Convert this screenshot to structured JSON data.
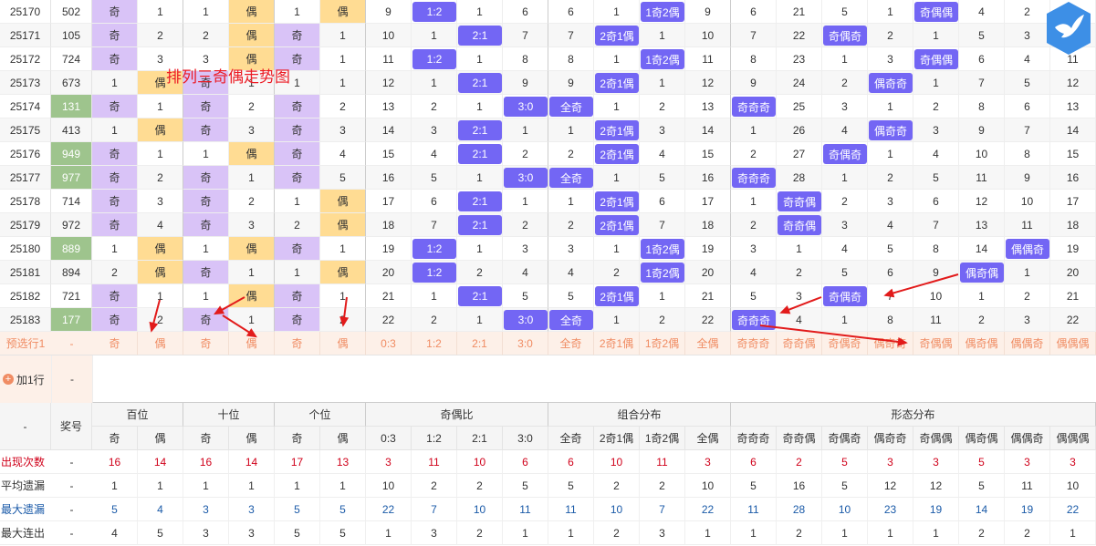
{
  "overlay_title": "排列三奇偶走势图",
  "colors": {
    "purple_cell": "#d9c3f7",
    "yellow_cell": "#ffdc93",
    "green_cell": "#9ec48d",
    "blue_block": "#7366f4",
    "predict_text": "#f08c63",
    "row_alt": "#f7f7f7"
  },
  "group_headers": {
    "award": "奖号",
    "hundreds": "百位",
    "tens": "十位",
    "units": "个位",
    "ratio": "奇偶比",
    "combo": "组合分布",
    "form": "形态分布",
    "dash": "-"
  },
  "sub_headers": [
    "奇",
    "偶",
    "奇",
    "偶",
    "奇",
    "偶",
    "0:3",
    "1:2",
    "2:1",
    "3:0",
    "全奇",
    "2奇1偶",
    "1奇2偶",
    "全偶",
    "奇奇奇",
    "奇奇偶",
    "奇偶奇",
    "偶奇奇",
    "奇偶偶",
    "偶奇偶",
    "偶偶奇",
    "偶偶偶"
  ],
  "rows": [
    {
      "issue": "25170",
      "num": "502",
      "cells": [
        "奇",
        "1",
        "1",
        "偶",
        "1",
        "偶",
        "9",
        "1:2",
        "1",
        "6",
        "6",
        "1",
        "1奇2偶",
        "9",
        "6",
        "21",
        "5",
        "1",
        "奇偶偶",
        "4",
        "2",
        ""
      ]
    },
    {
      "issue": "25171",
      "num": "105",
      "cells": [
        "奇",
        "2",
        "2",
        "偶",
        "奇",
        "1",
        "10",
        "1",
        "2:1",
        "7",
        "7",
        "2奇1偶",
        "1",
        "10",
        "7",
        "22",
        "奇偶奇",
        "2",
        "1",
        "5",
        "3",
        ""
      ]
    },
    {
      "issue": "25172",
      "num": "724",
      "cells": [
        "奇",
        "3",
        "3",
        "偶",
        "奇",
        "1",
        "11",
        "1:2",
        "1",
        "8",
        "8",
        "1",
        "1奇2偶",
        "11",
        "8",
        "23",
        "1",
        "3",
        "奇偶偶",
        "6",
        "4",
        "11"
      ]
    },
    {
      "issue": "25173",
      "num": "673",
      "cells": [
        "1",
        "偶",
        "奇",
        "1",
        "1",
        "1",
        "12",
        "1",
        "2:1",
        "9",
        "9",
        "2奇1偶",
        "1",
        "12",
        "9",
        "24",
        "2",
        "偶奇奇",
        "1",
        "7",
        "5",
        "12"
      ]
    },
    {
      "issue": "25174",
      "num": "131",
      "cells": [
        "奇",
        "1",
        "奇",
        "2",
        "奇",
        "2",
        "13",
        "2",
        "1",
        "3:0",
        "全奇",
        "1",
        "2",
        "13",
        "奇奇奇",
        "25",
        "3",
        "1",
        "2",
        "8",
        "6",
        "13"
      ]
    },
    {
      "issue": "25175",
      "num": "413",
      "cells": [
        "1",
        "偶",
        "奇",
        "3",
        "奇",
        "3",
        "14",
        "3",
        "2:1",
        "1",
        "1",
        "2奇1偶",
        "3",
        "14",
        "1",
        "26",
        "4",
        "偶奇奇",
        "3",
        "9",
        "7",
        "14"
      ]
    },
    {
      "issue": "25176",
      "num": "949",
      "cells": [
        "奇",
        "1",
        "1",
        "偶",
        "奇",
        "4",
        "15",
        "4",
        "2:1",
        "2",
        "2",
        "2奇1偶",
        "4",
        "15",
        "2",
        "27",
        "奇偶奇",
        "1",
        "4",
        "10",
        "8",
        "15"
      ]
    },
    {
      "issue": "25177",
      "num": "977",
      "cells": [
        "奇",
        "2",
        "奇",
        "1",
        "奇",
        "5",
        "16",
        "5",
        "1",
        "3:0",
        "全奇",
        "1",
        "5",
        "16",
        "奇奇奇",
        "28",
        "1",
        "2",
        "5",
        "11",
        "9",
        "16"
      ]
    },
    {
      "issue": "25178",
      "num": "714",
      "cells": [
        "奇",
        "3",
        "奇",
        "2",
        "1",
        "偶",
        "17",
        "6",
        "2:1",
        "1",
        "1",
        "2奇1偶",
        "6",
        "17",
        "1",
        "奇奇偶",
        "2",
        "3",
        "6",
        "12",
        "10",
        "17"
      ]
    },
    {
      "issue": "25179",
      "num": "972",
      "cells": [
        "奇",
        "4",
        "奇",
        "3",
        "2",
        "偶",
        "18",
        "7",
        "2:1",
        "2",
        "2",
        "2奇1偶",
        "7",
        "18",
        "2",
        "奇奇偶",
        "3",
        "4",
        "7",
        "13",
        "11",
        "18"
      ]
    },
    {
      "issue": "25180",
      "num": "889",
      "cells": [
        "1",
        "偶",
        "1",
        "偶",
        "奇",
        "1",
        "19",
        "1:2",
        "1",
        "3",
        "3",
        "1",
        "1奇2偶",
        "19",
        "3",
        "1",
        "4",
        "5",
        "8",
        "14",
        "偶偶奇",
        "19"
      ]
    },
    {
      "issue": "25181",
      "num": "894",
      "cells": [
        "2",
        "偶",
        "奇",
        "1",
        "1",
        "偶",
        "20",
        "1:2",
        "2",
        "4",
        "4",
        "2",
        "1奇2偶",
        "20",
        "4",
        "2",
        "5",
        "6",
        "9",
        "偶奇偶",
        "1",
        "20"
      ]
    },
    {
      "issue": "25182",
      "num": "721",
      "cells": [
        "奇",
        "1",
        "1",
        "偶",
        "奇",
        "1",
        "21",
        "1",
        "2:1",
        "5",
        "5",
        "2奇1偶",
        "1",
        "21",
        "5",
        "3",
        "奇偶奇",
        "7",
        "10",
        "1",
        "2",
        "21"
      ]
    },
    {
      "issue": "25183",
      "num": "177",
      "cells": [
        "奇",
        "2",
        "奇",
        "1",
        "奇",
        "2",
        "22",
        "2",
        "1",
        "3:0",
        "全奇",
        "1",
        "2",
        "22",
        "奇奇奇",
        "4",
        "1",
        "8",
        "11",
        "2",
        "3",
        "22"
      ]
    }
  ],
  "predict": {
    "label": "预选行1",
    "dash": "-",
    "cells": [
      "奇",
      "偶",
      "奇",
      "偶",
      "奇",
      "偶",
      "0:3",
      "1:2",
      "2:1",
      "3:0",
      "全奇",
      "2奇1偶",
      "1奇2偶",
      "全偶",
      "奇奇奇",
      "奇奇偶",
      "奇偶奇",
      "偶奇奇",
      "奇偶偶",
      "偶奇偶",
      "偶偶奇",
      "偶偶偶"
    ]
  },
  "add_row": {
    "label": "加1行",
    "dash": "-"
  },
  "stats": [
    {
      "label": "出现次数",
      "dash": "-",
      "values": [
        "16",
        "14",
        "16",
        "14",
        "17",
        "13",
        "3",
        "11",
        "10",
        "6",
        "6",
        "10",
        "11",
        "3",
        "6",
        "2",
        "5",
        "3",
        "3",
        "5",
        "3",
        "3"
      ]
    },
    {
      "label": "平均遗漏",
      "dash": "-",
      "values": [
        "1",
        "1",
        "1",
        "1",
        "1",
        "1",
        "10",
        "2",
        "2",
        "5",
        "5",
        "2",
        "2",
        "10",
        "5",
        "16",
        "5",
        "12",
        "12",
        "5",
        "11",
        "10"
      ]
    },
    {
      "label": "最大遗漏",
      "dash": "-",
      "values": [
        "5",
        "4",
        "3",
        "3",
        "5",
        "5",
        "22",
        "7",
        "10",
        "11",
        "11",
        "10",
        "7",
        "22",
        "11",
        "28",
        "10",
        "23",
        "19",
        "14",
        "19",
        "22"
      ]
    },
    {
      "label": "最大连出",
      "dash": "-",
      "values": [
        "4",
        "5",
        "3",
        "3",
        "5",
        "5",
        "1",
        "3",
        "2",
        "1",
        "1",
        "2",
        "3",
        "1",
        "1",
        "2",
        "1",
        "1",
        "1",
        "2",
        "2",
        "1"
      ]
    }
  ]
}
